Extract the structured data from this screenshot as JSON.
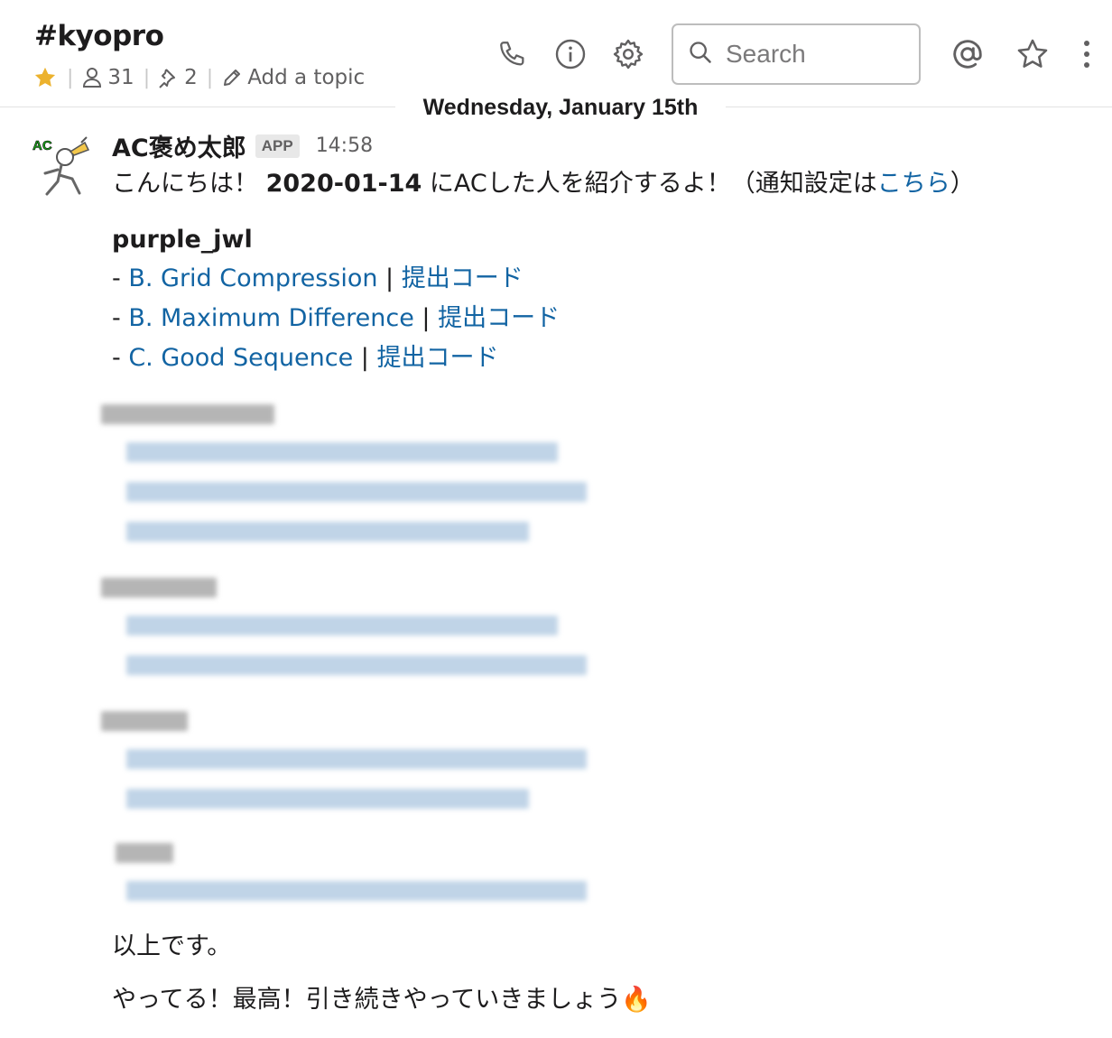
{
  "header": {
    "channel_name": "#kyopro",
    "member_count": "31",
    "pinned_count": "2",
    "add_topic": "Add a topic",
    "search_placeholder": "Search"
  },
  "date_divider": "Wednesday, January 15th",
  "message": {
    "sender": "AC褒め太郎",
    "badge": "APP",
    "time": "14:58",
    "intro_prefix": "こんにちは！ ",
    "intro_date": "2020-01-14",
    "intro_suffix": " にACした人を紹介するよ！（通知設定は",
    "intro_link": "こちら",
    "intro_close": "）",
    "user": "purple_jwl",
    "submissions": [
      {
        "problem": "B. Grid Compression",
        "code": "提出コード"
      },
      {
        "problem": "B. Maximum Difference",
        "code": "提出コード"
      },
      {
        "problem": "C. Good Sequence",
        "code": "提出コード"
      }
    ],
    "closing": "以上です。",
    "cheer": "やってる！最高！引き続きやっていきましょう",
    "cheer_emoji": "🔥"
  },
  "colors": {
    "link": "#1264a3",
    "star": "#ecb22e",
    "text": "#1d1c1d",
    "muted": "#616061"
  }
}
